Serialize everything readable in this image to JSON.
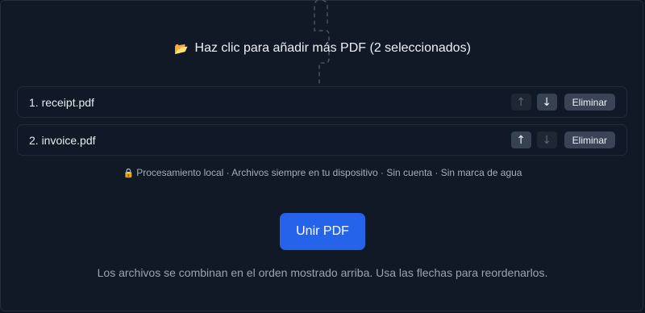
{
  "dropzone": {
    "icon": "folder-icon",
    "icon_glyph": "📂",
    "text": "Haz clic para añadir más PDF (2 seleccionados)"
  },
  "files": [
    {
      "label": "1. receipt.pdf",
      "up_enabled": false,
      "down_enabled": true,
      "remove_label": "Eliminar"
    },
    {
      "label": "2. invoice.pdf",
      "up_enabled": true,
      "down_enabled": false,
      "remove_label": "Eliminar"
    }
  ],
  "arrows": {
    "up": "↑",
    "down": "↓"
  },
  "privacy": {
    "icon": "lock-icon",
    "icon_glyph": "🔒",
    "text": "Procesamiento local · Archivos siempre en tu dispositivo · Sin cuenta · Sin marca de agua"
  },
  "merge_button": {
    "label": "Unir PDF"
  },
  "footnote": "Los archivos se combinan en el orden mostrado arriba. Usa las flechas para reordenarlos.",
  "colors": {
    "background": "#0f1522",
    "accent": "#2563eb",
    "row_border": "#222a38",
    "button_bg": "#364152"
  }
}
